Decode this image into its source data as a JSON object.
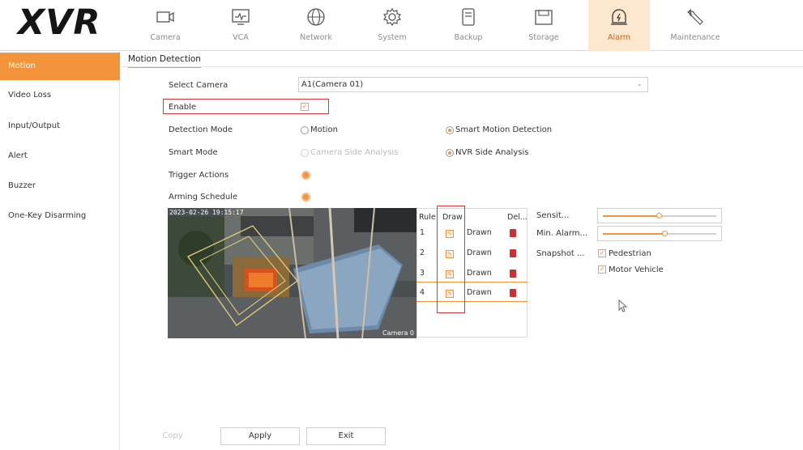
{
  "app": {
    "logo": "XVR"
  },
  "nav": [
    {
      "label": "Camera",
      "icon": "camera-icon"
    },
    {
      "label": "VCA",
      "icon": "vca-icon"
    },
    {
      "label": "Network",
      "icon": "globe-icon"
    },
    {
      "label": "System",
      "icon": "gear-icon"
    },
    {
      "label": "Backup",
      "icon": "backup-icon"
    },
    {
      "label": "Storage",
      "icon": "storage-icon"
    },
    {
      "label": "Alarm",
      "icon": "alarm-icon",
      "active": true
    },
    {
      "label": "Maintenance",
      "icon": "wrench-icon"
    }
  ],
  "sidebar": {
    "items": [
      {
        "label": "Motion",
        "active": true
      },
      {
        "label": "Video Loss"
      },
      {
        "label": "Input/Output"
      },
      {
        "label": "Alert"
      },
      {
        "label": "Buzzer"
      },
      {
        "label": "One-Key Disarming"
      }
    ]
  },
  "main": {
    "tab": "Motion Detection",
    "select_camera": {
      "label": "Select Camera",
      "value": "A1(Camera 01)"
    },
    "enable": {
      "label": "Enable",
      "checked": true
    },
    "detection_mode": {
      "label": "Detection Mode",
      "options": [
        "Motion",
        "Smart Motion Detection"
      ],
      "selected": "Smart Motion Detection"
    },
    "smart_mode": {
      "label": "Smart Mode",
      "options": [
        "Camera Side Analysis",
        "NVR Side Analysis"
      ],
      "selected": "NVR Side Analysis"
    },
    "trigger_actions": {
      "label": "Trigger Actions"
    },
    "arming_schedule": {
      "label": "Arming Schedule"
    },
    "preview": {
      "timestamp": "2023-02-26 19:15:17",
      "camera_label": "Camera 0"
    },
    "rule_table": {
      "headers": [
        "Rule",
        "Draw",
        "Del..."
      ],
      "rows": [
        {
          "rule": "1",
          "status": "Drawn"
        },
        {
          "rule": "2",
          "status": "Drawn"
        },
        {
          "rule": "3",
          "status": "Drawn"
        },
        {
          "rule": "4",
          "status": "Drawn"
        }
      ]
    },
    "sensitivity": {
      "label": "Sensit...",
      "level": 0.5
    },
    "min_alarm": {
      "label": "Min. Alarm...",
      "level": 0.55
    },
    "snapshot": {
      "label": "Snapshot ...",
      "options": [
        {
          "label": "Pedestrian",
          "checked": true
        },
        {
          "label": "Motor Vehicle",
          "checked": true
        }
      ]
    }
  },
  "buttons": {
    "copy": "Copy",
    "apply": "Apply",
    "exit": "Exit"
  },
  "colors": {
    "accent": "#f3943a",
    "highlight": "#d63a3a",
    "active_nav_bg": "#fde7cf"
  }
}
